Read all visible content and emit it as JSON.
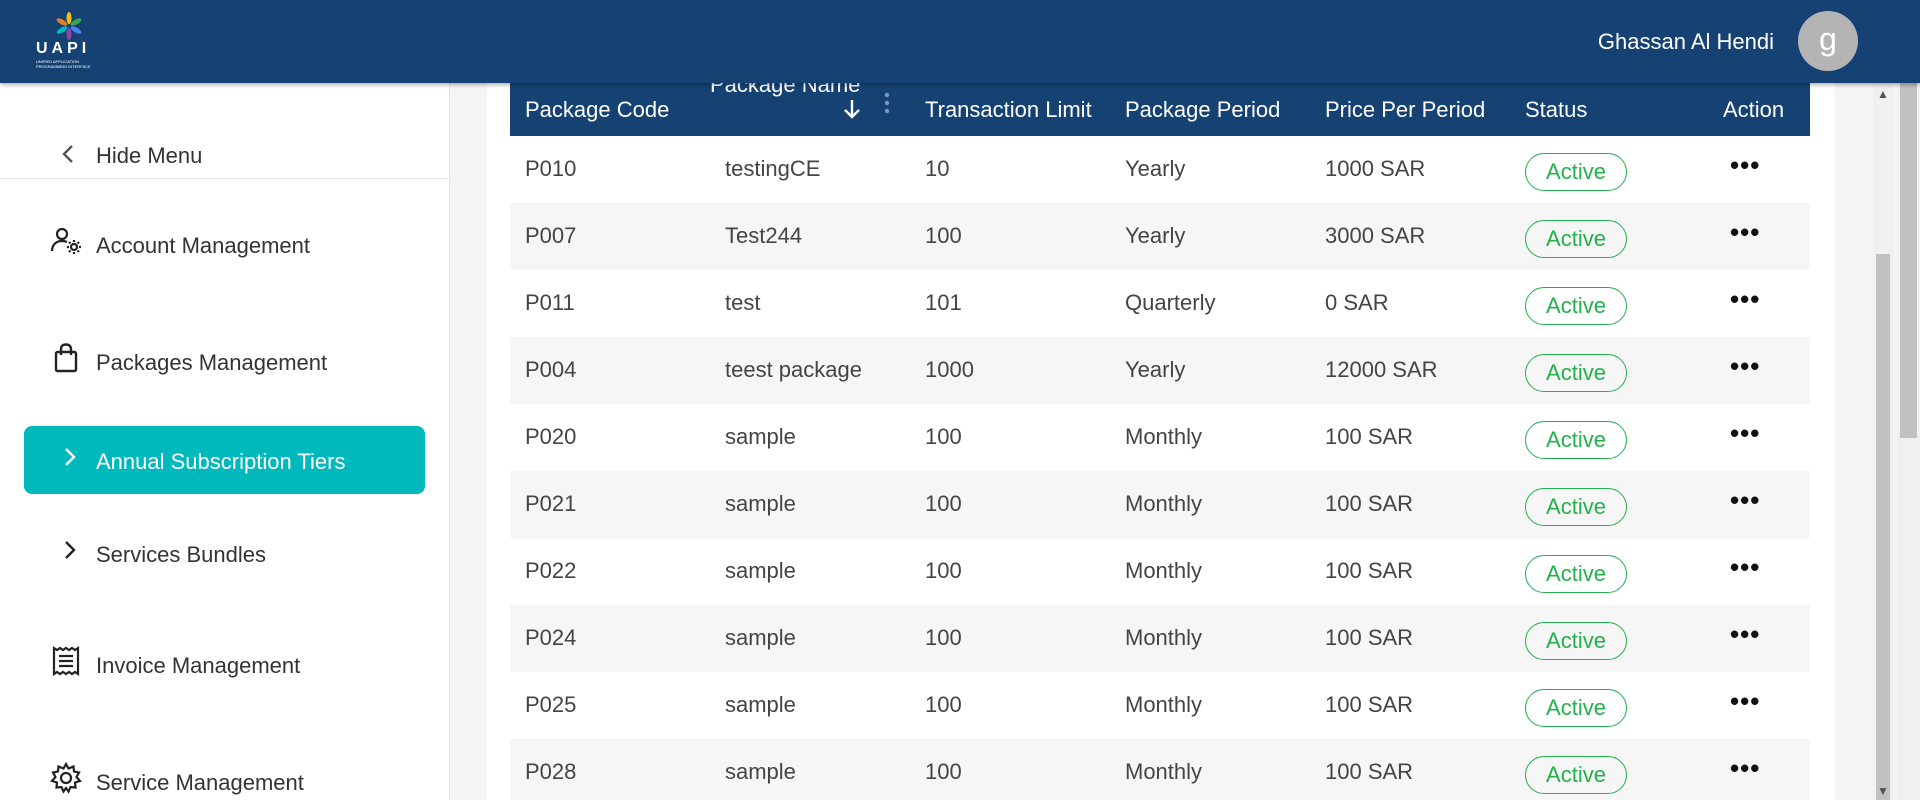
{
  "header": {
    "logo_text": "UAPI",
    "logo_subtitle": "UNIFIED APPLICATION PROGRAMMING INTERFACE",
    "user_name": "Ghassan Al Hendi",
    "avatar_letter": "g",
    "bg_color": "#154273"
  },
  "sidebar": {
    "hide_menu": "Hide Menu",
    "items": [
      {
        "label": "Account Management",
        "icon": "user-gear-icon"
      },
      {
        "label": "Packages Management",
        "icon": "shopping-bag-icon"
      },
      {
        "label": "Annual Subscription Tiers",
        "icon": "chevron-right-icon",
        "active": true
      },
      {
        "label": "Services Bundles",
        "icon": "chevron-right-icon"
      },
      {
        "label": "Invoice Management",
        "icon": "receipt-icon"
      },
      {
        "label": "Service Management",
        "icon": "gear-icon"
      }
    ],
    "active_color": "#00b9bd"
  },
  "table": {
    "columns": [
      "Package Code",
      "Package Name",
      "Transaction Limit",
      "Package Period",
      "Price Per Period",
      "Status",
      "Action"
    ],
    "rows": [
      {
        "code": "P010",
        "name": "testingCE",
        "limit": "10",
        "period": "Yearly",
        "price": "1000 SAR",
        "status": "Active"
      },
      {
        "code": "P007",
        "name": "Test244",
        "limit": "100",
        "period": "Yearly",
        "price": "3000 SAR",
        "status": "Active"
      },
      {
        "code": "P011",
        "name": "test",
        "limit": "101",
        "period": "Quarterly",
        "price": "0 SAR",
        "status": "Active"
      },
      {
        "code": "P004",
        "name": "teest package",
        "limit": "1000",
        "period": "Yearly",
        "price": "12000 SAR",
        "status": "Active"
      },
      {
        "code": "P020",
        "name": "sample",
        "limit": "100",
        "period": "Monthly",
        "price": "100 SAR",
        "status": "Active"
      },
      {
        "code": "P021",
        "name": "sample",
        "limit": "100",
        "period": "Monthly",
        "price": "100 SAR",
        "status": "Active"
      },
      {
        "code": "P022",
        "name": "sample",
        "limit": "100",
        "period": "Monthly",
        "price": "100 SAR",
        "status": "Active"
      },
      {
        "code": "P024",
        "name": "sample",
        "limit": "100",
        "period": "Monthly",
        "price": "100 SAR",
        "status": "Active"
      },
      {
        "code": "P025",
        "name": "sample",
        "limit": "100",
        "period": "Monthly",
        "price": "100 SAR",
        "status": "Active"
      },
      {
        "code": "P028",
        "name": "sample",
        "limit": "100",
        "period": "Monthly",
        "price": "100 SAR",
        "status": "Active"
      }
    ],
    "action_label": "•••",
    "status_color": "#22b14c"
  }
}
